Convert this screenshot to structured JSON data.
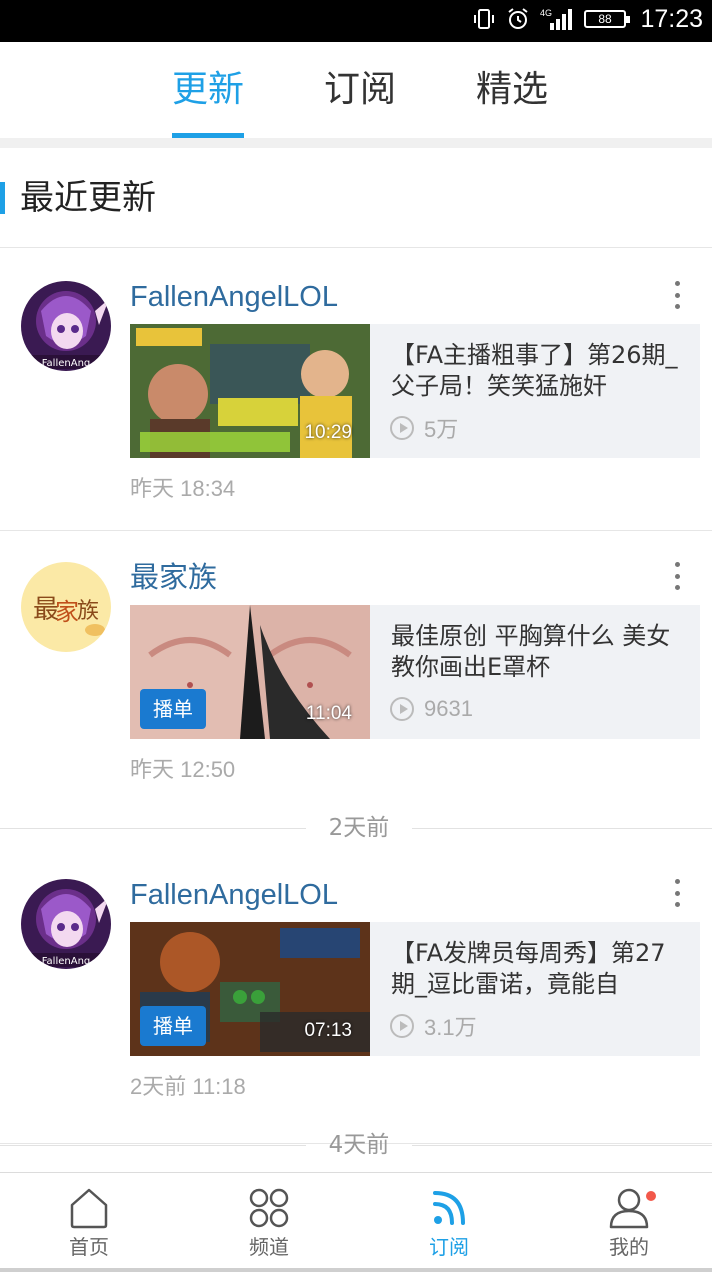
{
  "status_bar": {
    "time": "17:23",
    "battery": "88",
    "network": "4G"
  },
  "top_tabs": [
    {
      "label": "更新",
      "active": true
    },
    {
      "label": "订阅",
      "active": false
    },
    {
      "label": "精选",
      "active": false
    }
  ],
  "section_title": "最近更新",
  "feed": [
    {
      "author": "FallenAngelLOL",
      "title": "【FA主播粗事了】第26期_父子局！笑笑猛施奸",
      "duration": "10:29",
      "views": "5万",
      "time": "昨天 18:34",
      "badge": ""
    },
    {
      "author": "最家族",
      "title": "最佳原创 平胸算什么 美女教你画出E罩杯",
      "duration": "11:04",
      "views": "9631",
      "time": "昨天 12:50",
      "badge": "播单"
    },
    {
      "author": "FallenAngelLOL",
      "title": "【FA发牌员每周秀】第27期_逗比雷诺，竟能自",
      "duration": "07:13",
      "views": "3.1万",
      "time": "2天前 11:18",
      "badge": "播单"
    }
  ],
  "date_separators": [
    "2天前",
    "4天前"
  ],
  "bottom_tabs": [
    {
      "label": "首页",
      "icon": "home-icon"
    },
    {
      "label": "频道",
      "icon": "grid-icon"
    },
    {
      "label": "订阅",
      "icon": "subscribe-rss-icon",
      "active": true
    },
    {
      "label": "我的",
      "icon": "profile-icon"
    }
  ],
  "colors": {
    "accent": "#1ea0e6",
    "author": "#2f6b9e",
    "badge": "#1a7ad0",
    "notification": "#f2584a"
  }
}
